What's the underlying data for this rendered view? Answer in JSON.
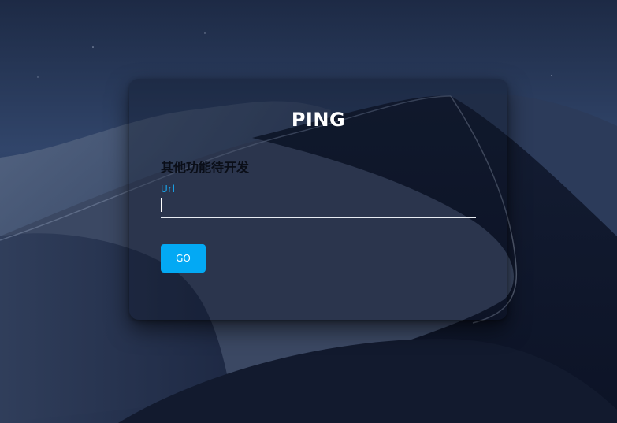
{
  "login_box": {
    "title": "PING",
    "notice": "其他功能待开发",
    "url_field": {
      "label": "Url",
      "value": "",
      "placeholder": ""
    },
    "submit_label": "GO"
  },
  "colors": {
    "accent": "#03a9f4",
    "label": "#1aa3e8",
    "title": "#ffffff",
    "notice": "#0a0e18"
  }
}
